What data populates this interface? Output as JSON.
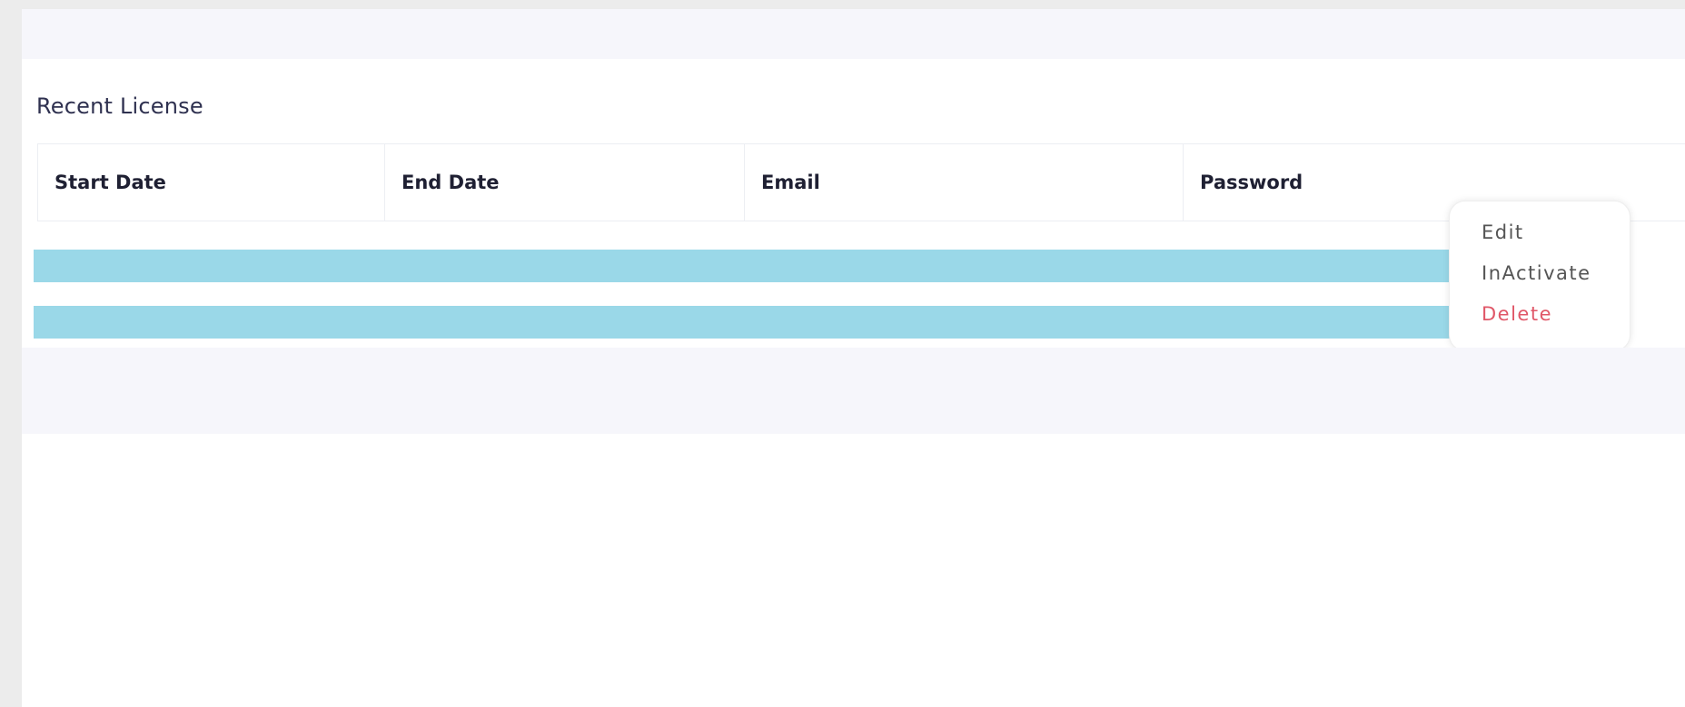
{
  "section": {
    "title": "Recent License"
  },
  "table": {
    "columns": [
      "Start Date",
      "End Date",
      "Email",
      "Password"
    ]
  },
  "action_menu": {
    "items": [
      "Edit",
      "InActivate",
      "Delete"
    ]
  },
  "colors": {
    "row_highlight": "#9ad8e8",
    "delete": "#e05768",
    "band": "#f6f6fb"
  }
}
